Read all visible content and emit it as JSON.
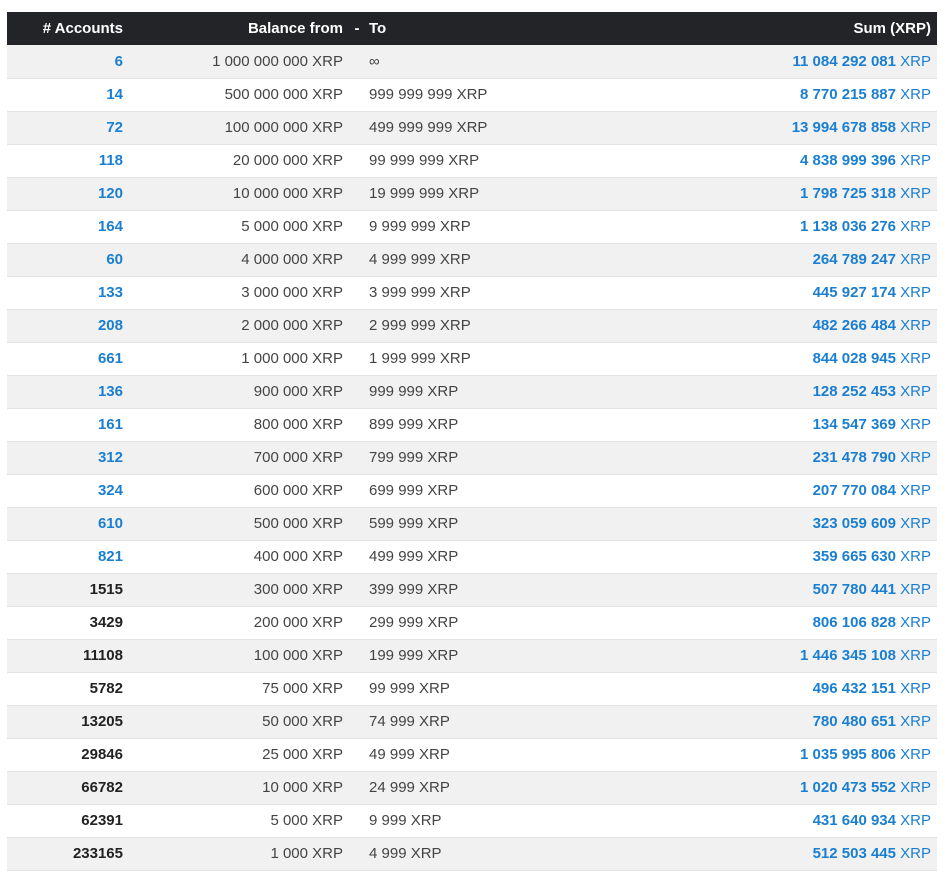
{
  "header": {
    "accounts": "# Accounts",
    "balance_from": "Balance from",
    "dash": "-",
    "to": "To",
    "sum": "Sum (XRP)"
  },
  "colors": {
    "header_bg": "#222428",
    "link": "#1a7fd0",
    "row_alt": "#f1f1f1"
  },
  "rows": [
    {
      "accounts": "6",
      "link": true,
      "from": "1 000 000 000 XRP",
      "to": "∞",
      "sum": "11 084 292 081",
      "unit": "XRP"
    },
    {
      "accounts": "14",
      "link": true,
      "from": "500 000 000 XRP",
      "to": "999 999 999 XRP",
      "sum": "8 770 215 887",
      "unit": "XRP"
    },
    {
      "accounts": "72",
      "link": true,
      "from": "100 000 000 XRP",
      "to": "499 999 999 XRP",
      "sum": "13 994 678 858",
      "unit": "XRP"
    },
    {
      "accounts": "118",
      "link": true,
      "from": "20 000 000 XRP",
      "to": "99 999 999 XRP",
      "sum": "4 838 999 396",
      "unit": "XRP"
    },
    {
      "accounts": "120",
      "link": true,
      "from": "10 000 000 XRP",
      "to": "19 999 999 XRP",
      "sum": "1 798 725 318",
      "unit": "XRP"
    },
    {
      "accounts": "164",
      "link": true,
      "from": "5 000 000 XRP",
      "to": "9 999 999 XRP",
      "sum": "1 138 036 276",
      "unit": "XRP"
    },
    {
      "accounts": "60",
      "link": true,
      "from": "4 000 000 XRP",
      "to": "4 999 999 XRP",
      "sum": "264 789 247",
      "unit": "XRP"
    },
    {
      "accounts": "133",
      "link": true,
      "from": "3 000 000 XRP",
      "to": "3 999 999 XRP",
      "sum": "445 927 174",
      "unit": "XRP"
    },
    {
      "accounts": "208",
      "link": true,
      "from": "2 000 000 XRP",
      "to": "2 999 999 XRP",
      "sum": "482 266 484",
      "unit": "XRP"
    },
    {
      "accounts": "661",
      "link": true,
      "from": "1 000 000 XRP",
      "to": "1 999 999 XRP",
      "sum": "844 028 945",
      "unit": "XRP"
    },
    {
      "accounts": "136",
      "link": true,
      "from": "900 000 XRP",
      "to": "999 999 XRP",
      "sum": "128 252 453",
      "unit": "XRP"
    },
    {
      "accounts": "161",
      "link": true,
      "from": "800 000 XRP",
      "to": "899 999 XRP",
      "sum": "134 547 369",
      "unit": "XRP"
    },
    {
      "accounts": "312",
      "link": true,
      "from": "700 000 XRP",
      "to": "799 999 XRP",
      "sum": "231 478 790",
      "unit": "XRP"
    },
    {
      "accounts": "324",
      "link": true,
      "from": "600 000 XRP",
      "to": "699 999 XRP",
      "sum": "207 770 084",
      "unit": "XRP"
    },
    {
      "accounts": "610",
      "link": true,
      "from": "500 000 XRP",
      "to": "599 999 XRP",
      "sum": "323 059 609",
      "unit": "XRP"
    },
    {
      "accounts": "821",
      "link": true,
      "from": "400 000 XRP",
      "to": "499 999 XRP",
      "sum": "359 665 630",
      "unit": "XRP"
    },
    {
      "accounts": "1515",
      "link": false,
      "from": "300 000 XRP",
      "to": "399 999 XRP",
      "sum": "507 780 441",
      "unit": "XRP"
    },
    {
      "accounts": "3429",
      "link": false,
      "from": "200 000 XRP",
      "to": "299 999 XRP",
      "sum": "806 106 828",
      "unit": "XRP"
    },
    {
      "accounts": "11108",
      "link": false,
      "from": "100 000 XRP",
      "to": "199 999 XRP",
      "sum": "1 446 345 108",
      "unit": "XRP"
    },
    {
      "accounts": "5782",
      "link": false,
      "from": "75 000 XRP",
      "to": "99 999 XRP",
      "sum": "496 432 151",
      "unit": "XRP"
    },
    {
      "accounts": "13205",
      "link": false,
      "from": "50 000 XRP",
      "to": "74 999 XRP",
      "sum": "780 480 651",
      "unit": "XRP"
    },
    {
      "accounts": "29846",
      "link": false,
      "from": "25 000 XRP",
      "to": "49 999 XRP",
      "sum": "1 035 995 806",
      "unit": "XRP"
    },
    {
      "accounts": "66782",
      "link": false,
      "from": "10 000 XRP",
      "to": "24 999 XRP",
      "sum": "1 020 473 552",
      "unit": "XRP"
    },
    {
      "accounts": "62391",
      "link": false,
      "from": "5 000 XRP",
      "to": "9 999 XRP",
      "sum": "431 640 934",
      "unit": "XRP"
    },
    {
      "accounts": "233165",
      "link": false,
      "from": "1 000 XRP",
      "to": "4 999 XRP",
      "sum": "512 503 445",
      "unit": "XRP"
    }
  ]
}
